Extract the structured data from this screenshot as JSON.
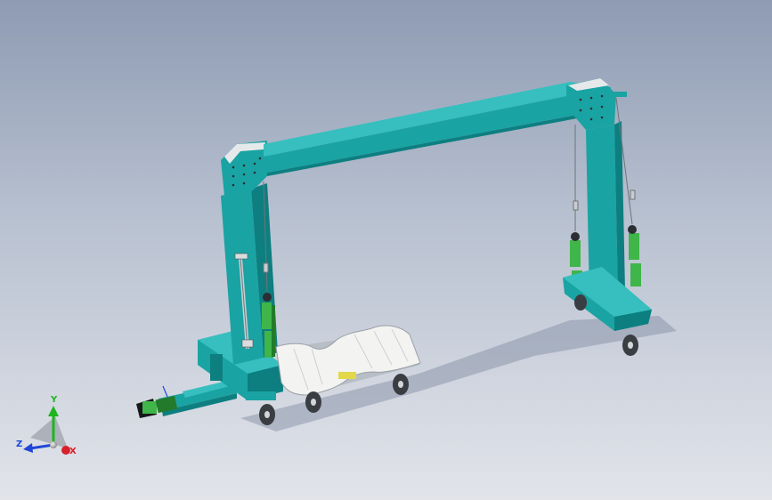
{
  "scene": {
    "kind": "cad-3d-model",
    "colors": {
      "frame": "#1aa3a3",
      "frame_light": "#37bfbf",
      "frame_dark": "#0d7f80",
      "cylinder": "#3fb54a",
      "cylinder_dark": "#227a2a",
      "platform": "#f3f3f1",
      "plate": "#b8bec6",
      "wheel": "#3a3d42"
    }
  },
  "triad": {
    "y_label": "Y",
    "z_label": "Z",
    "x_label": "X",
    "y_color": "#1fb51f",
    "z_color": "#2147d8",
    "x_color": "#d8202a"
  }
}
